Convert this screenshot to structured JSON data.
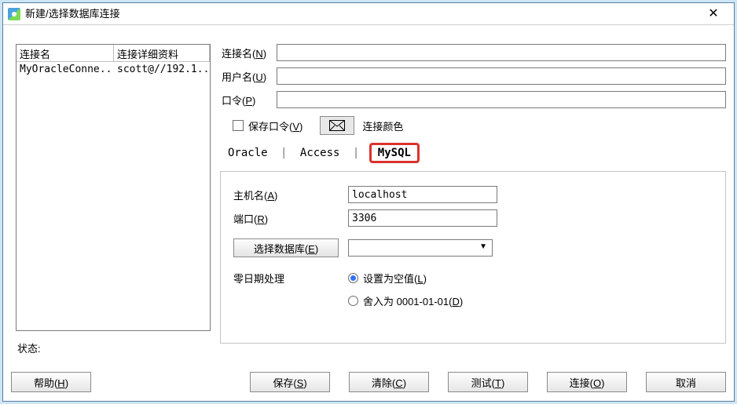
{
  "window": {
    "title": "新建/选择数据库连接"
  },
  "connlist": {
    "col1": "连接名",
    "col2": "连接详细资料",
    "rows": [
      {
        "name": "MyOracleConne...",
        "detail": "scott@//192.1..."
      }
    ]
  },
  "status": {
    "label": "状态:"
  },
  "form": {
    "conn_name_label": "连接名(N)",
    "conn_name_hotkey": "N",
    "conn_name_value": "",
    "user_label": "用户名(U)",
    "user_hotkey": "U",
    "user_value": "",
    "pass_label": "口令(P)",
    "pass_hotkey": "P",
    "pass_value": "",
    "save_pass_label": "保存口令(V)",
    "color_label": "连接颜色"
  },
  "tabs": {
    "t0": "Oracle",
    "t1": "Access",
    "t2": "MySQL"
  },
  "mysql": {
    "host_label": "主机名(A)",
    "host_value": "localhost",
    "port_label": "端口(R)",
    "port_value": "3306",
    "select_db_btn": "选择数据库(E)",
    "select_db_value": "",
    "zero_label": "零日期处理",
    "radio_null": "设置为空值(L)",
    "radio_round": "舍入为 0001-01-01(D)"
  },
  "footer": {
    "help": "帮助(H)",
    "save": "保存(S)",
    "clear": "清除(C)",
    "test": "测试(T)",
    "connect": "连接(O)",
    "cancel": "取消"
  }
}
